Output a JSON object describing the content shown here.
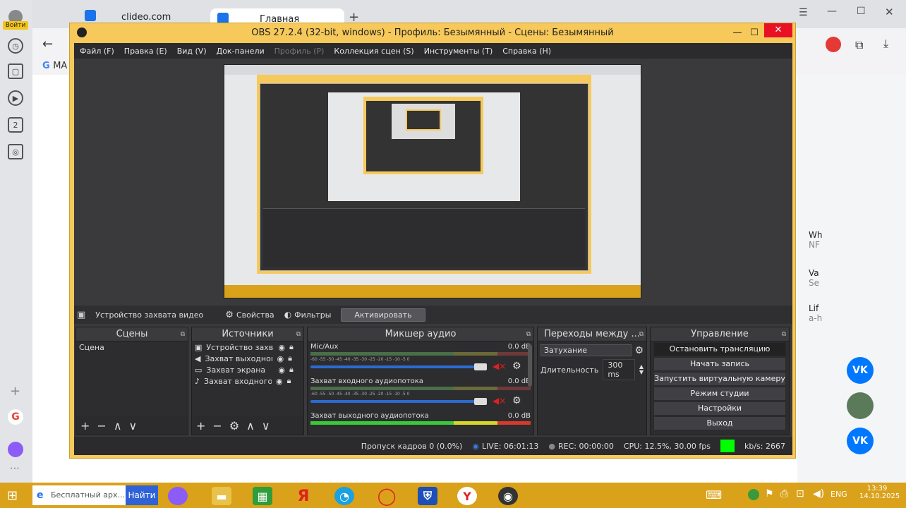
{
  "browser": {
    "tabs": [
      {
        "label": "clideo.com"
      },
      {
        "label": "Главная"
      }
    ],
    "login_label": "Войти",
    "bookmark_label": "MA",
    "rail_badge": "2",
    "right_panel": {
      "items": [
        {
          "title": "Wh",
          "sub": "NF"
        },
        {
          "title": "Va",
          "sub": "Se"
        },
        {
          "title": "Lif",
          "sub": "a-h"
        }
      ],
      "vk": "VK"
    }
  },
  "obs": {
    "window_title": "OBS 27.2.4 (32-bit, windows) - Профиль: Безымянный - Сцены: Безымянный",
    "menu": [
      "Файл (F)",
      "Правка (E)",
      "Вид (V)",
      "Док-панели",
      "Профиль (P)",
      "Коллекция сцен (S)",
      "Инструменты (T)",
      "Справка (H)"
    ],
    "source_toolbar": {
      "source_name": "Устройство захвата видео",
      "properties": "Свойства",
      "filters": "Фильтры",
      "activate": "Активировать"
    },
    "scenes": {
      "title": "Сцены",
      "items": [
        "Сцена"
      ]
    },
    "sources": {
      "title": "Источники",
      "items": [
        "Устройство захват",
        "Захват выходного",
        "Захват экрана",
        "Захват входного а"
      ]
    },
    "mixer": {
      "title": "Микшер аудио",
      "scale": "-60 -55 -50 -45 -40 -35 -30 -25 -20 -15 -10 -5 0",
      "channels": [
        {
          "name": "Mic/Aux",
          "db": "0.0 dB",
          "level": 0.95
        },
        {
          "name": "Захват входного аудиопотока",
          "db": "0.0 dB",
          "level": 0.95
        },
        {
          "name": "Захват выходного аудиопотока",
          "db": "0.0 dB",
          "level": 0.95
        }
      ]
    },
    "transitions": {
      "title": "Переходы между ...",
      "selected": "Затухание",
      "duration_label": "Длительность",
      "duration_value": "300 ms"
    },
    "controls": {
      "title": "Управление",
      "buttons": [
        "Остановить трансляцию",
        "Начать запись",
        "Запустить виртуальную камеру",
        "Режим студии",
        "Настройки",
        "Выход"
      ]
    },
    "status": {
      "dropped": "Пропуск кадров 0 (0.0%)",
      "live": "LIVE: 06:01:13",
      "rec": "REC: 00:00:00",
      "cpu": "CPU: 12.5%, 30.00 fps",
      "kbps": "kb/s: 2667",
      "indicator_color": "#00ff00"
    }
  },
  "taskbar": {
    "search_text": "Бесплатный арх...",
    "search_button": "Найти",
    "lang": "ENG",
    "time": "13:39",
    "date": "14.10.2025",
    "yandex_letter": "Я"
  },
  "colors": {
    "obs_frame": "#f6c95a",
    "taskbar": "#d9a21a",
    "close_red": "#e81123"
  }
}
